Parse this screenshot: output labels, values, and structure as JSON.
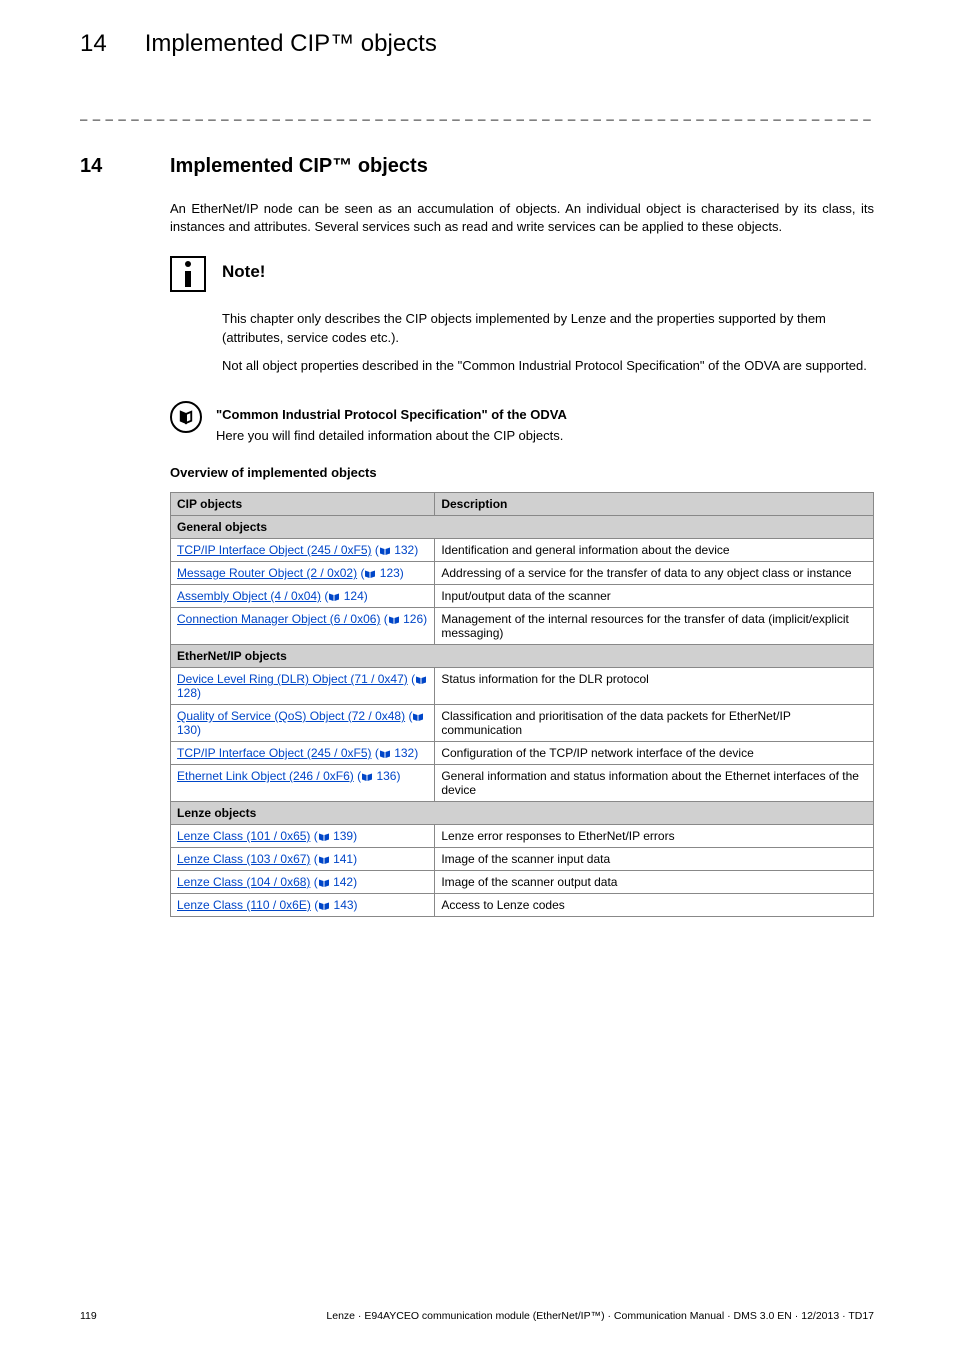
{
  "header": {
    "chapter_num": "14",
    "chapter_title": "Implemented CIP™ objects"
  },
  "section": {
    "num": "14",
    "title": "Implemented CIP™ objects"
  },
  "intro": "An EtherNet/IP node can be seen as an accumulation of objects. An individual object is characterised by its class, its instances and attributes. Several services such as read and write services can be applied to these objects.",
  "note": {
    "title": "Note!",
    "body1": "This chapter only describes the CIP objects implemented by Lenze and the properties supported by them (attributes, service codes etc.).",
    "body2": "Not all object properties described in the \"Common Industrial Protocol Specification\" of the ODVA are supported."
  },
  "reference": {
    "title": "\"Common Industrial Protocol Specification\" of the ODVA",
    "body": "Here you will find detailed information about the CIP objects."
  },
  "overview_heading": "Overview of implemented objects",
  "table": {
    "headers": {
      "col1": "CIP objects",
      "col2": "Description"
    },
    "groups": [
      {
        "label": "General objects",
        "rows": [
          {
            "link": "TCP/IP Interface Object (245 / 0xF5)",
            "page": "132",
            "desc": "Identification and general information about the device"
          },
          {
            "link": "Message Router Object (2 / 0x02)",
            "page": "123",
            "desc": "Addressing of a service for the transfer of data to any object class or instance"
          },
          {
            "link": "Assembly Object (4 / 0x04)",
            "page": "124",
            "desc": "Input/output data of the scanner"
          },
          {
            "link": "Connection Manager Object (6 / 0x06)",
            "page": "126",
            "desc": "Management of the internal resources for the transfer of data (implicit/explicit messaging)"
          }
        ]
      },
      {
        "label": "EtherNet/IP objects",
        "rows": [
          {
            "link": "Device Level Ring (DLR) Object (71 / 0x47)",
            "page": "128",
            "desc": "Status information for the DLR protocol"
          },
          {
            "link": "Quality of Service (QoS) Object (72 / 0x48)",
            "page": "130",
            "desc": "Classification and prioritisation of the data packets for EtherNet/IP communication"
          },
          {
            "link": "TCP/IP Interface Object (245 / 0xF5)",
            "page": "132",
            "desc": "Configuration of the TCP/IP network interface of the device"
          },
          {
            "link": "Ethernet Link Object (246 / 0xF6)",
            "page": "136",
            "desc": "General information and status information about the Ethernet interfaces of the device"
          }
        ]
      },
      {
        "label": "Lenze objects",
        "rows": [
          {
            "link": "Lenze Class (101 / 0x65)",
            "page": "139",
            "desc": "Lenze error responses to EtherNet/IP errors"
          },
          {
            "link": "Lenze Class (103 / 0x67)",
            "page": "141",
            "desc": "Image of the scanner input data"
          },
          {
            "link": "Lenze Class (104 / 0x68)",
            "page": "142",
            "desc": "Image of the scanner output data"
          },
          {
            "link": "Lenze Class (110 / 0x6E)",
            "page": "143",
            "desc": "Access to Lenze codes"
          }
        ]
      }
    ]
  },
  "footer": {
    "page": "119",
    "info": "Lenze · E94AYCEO communication module (EtherNet/IP™) · Communication Manual · DMS 3.0 EN · 12/2013 · TD17"
  },
  "icons": {
    "info": "info-icon",
    "reference": "reference-icon",
    "book": "book-icon"
  }
}
